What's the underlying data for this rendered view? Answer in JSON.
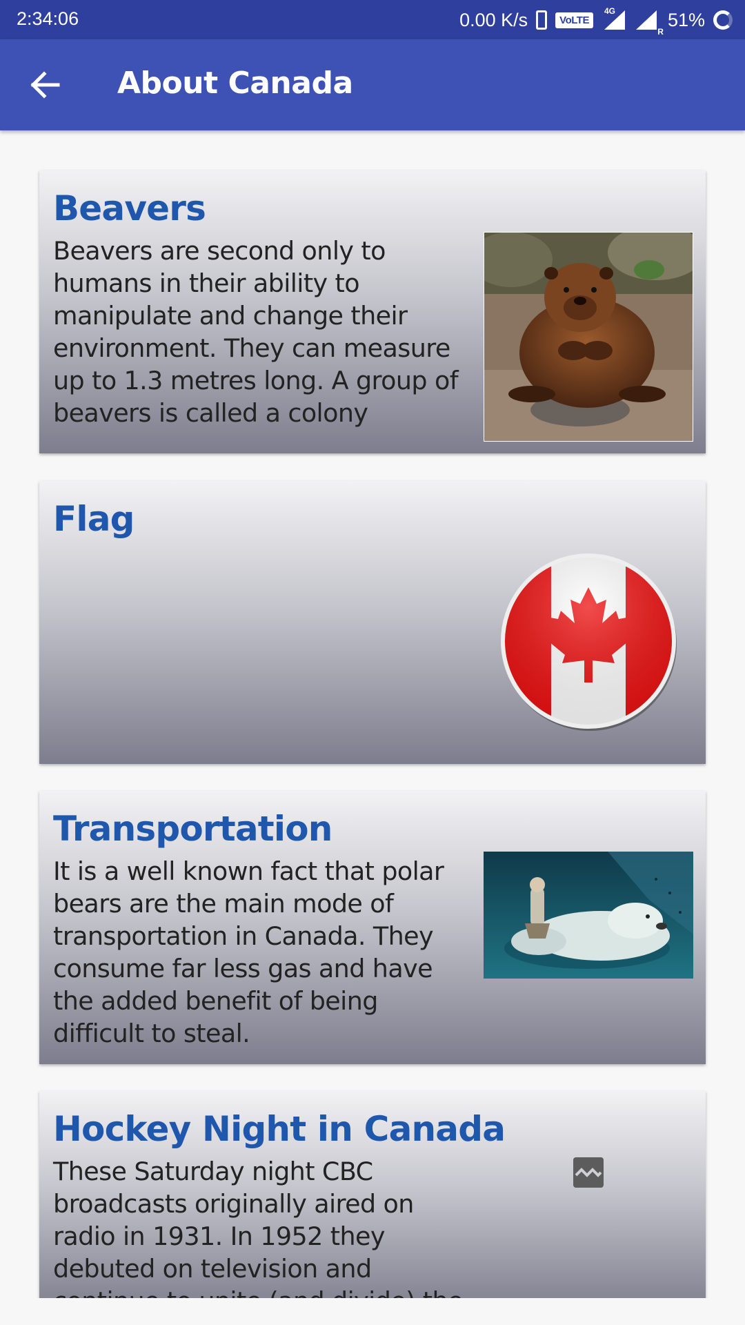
{
  "status_bar": {
    "time": "2:34:06",
    "network_speed": "0.00 K/s",
    "volte_label": "VoLTE",
    "network_type": "4G",
    "roaming_label": "R",
    "battery": "51%"
  },
  "app_bar": {
    "title": "About Canada",
    "back_icon": "arrow-back-icon",
    "background_color": "#3e51b5"
  },
  "cards": [
    {
      "title": "Beavers",
      "text": "Beavers are second only to humans in their ability to manipulate and change their environment. They can measure up to 1.3 metres long. A group of beavers is called a colony",
      "image": "beaver-photo"
    },
    {
      "title": "Flag",
      "text": "",
      "image": "canada-flag-button"
    },
    {
      "title": "Transportation",
      "text": "It is a well known fact that polar bears are the main mode of transportation in Canada. They consume far less gas and have the added benefit of being difficult to steal.",
      "image": "polar-bear-photo"
    },
    {
      "title": "Hockey Night in Canada",
      "text": "These Saturday night CBC broadcasts originally aired on radio in 1931. In 1952 they debuted on television and continue to unite (and divide) the nation each week.",
      "image": "broken-image-icon"
    }
  ],
  "colors": {
    "status_bar": "#2f3f9e",
    "card_title": "#1e57ac",
    "canada_red": "#ee1111"
  }
}
